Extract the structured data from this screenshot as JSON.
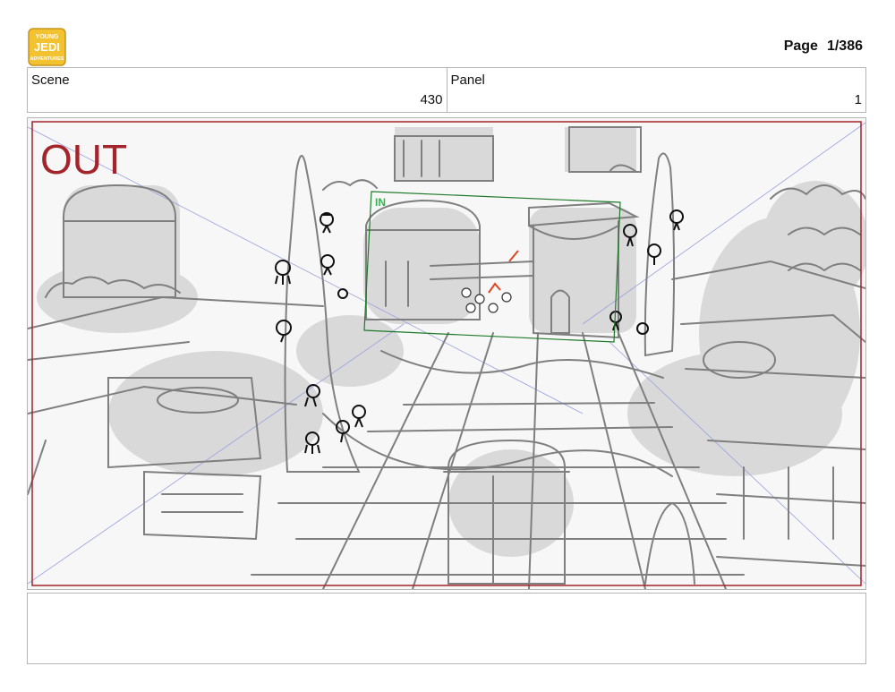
{
  "header": {
    "logo_text_top": "YOUNG",
    "logo_text_mid": "JEDI",
    "logo_text_bottom": "ADVENTURES",
    "page_label": "Page",
    "page_value": "1/386"
  },
  "info": {
    "scene_label": "Scene",
    "scene_value": "430",
    "panel_label": "Panel",
    "panel_value": "1"
  },
  "panel": {
    "out_label": "OUT",
    "in_label": "IN"
  },
  "colors": {
    "out_frame": "#a3242b",
    "in_frame": "#1f7a2a",
    "logo": "#f2c230",
    "accent_mark": "#e0461f"
  }
}
